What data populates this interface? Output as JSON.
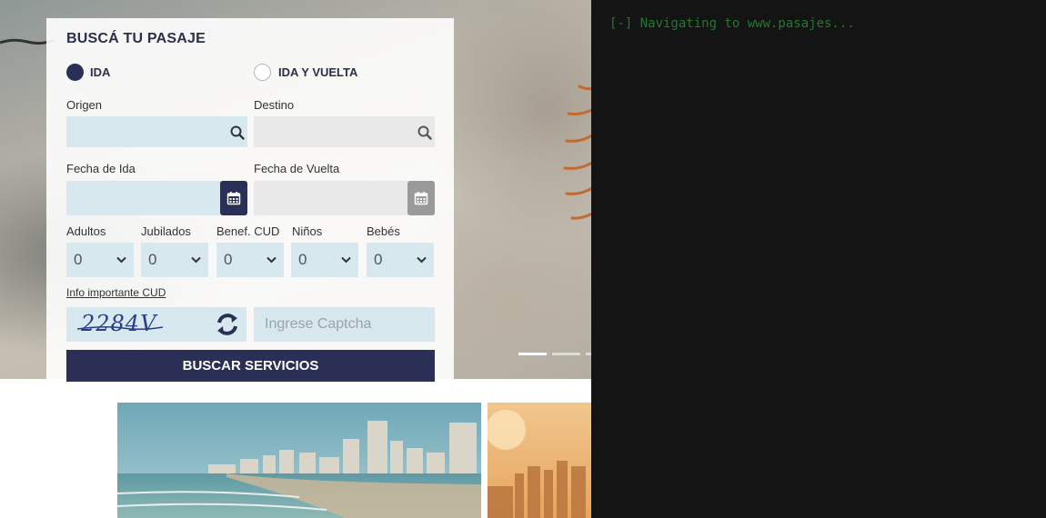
{
  "booking": {
    "title": "BUSCÁ TU PASAJE",
    "trip_type": {
      "options": [
        {
          "label": "IDA",
          "selected": true
        },
        {
          "label": "IDA Y VUELTA",
          "selected": false
        }
      ]
    },
    "origin": {
      "label": "Origen",
      "value": "",
      "placeholder": ""
    },
    "destination": {
      "label": "Destino",
      "value": "",
      "placeholder": ""
    },
    "departure_date": {
      "label": "Fecha de Ida",
      "value": ""
    },
    "return_date": {
      "label": "Fecha de Vuelta",
      "value": ""
    },
    "passengers": [
      {
        "label": "Adultos",
        "value": "0"
      },
      {
        "label": "Jubilados",
        "value": "0"
      },
      {
        "label": "Benef. CUD",
        "value": "0"
      },
      {
        "label": "Niños",
        "value": "0"
      },
      {
        "label": "Bebés",
        "value": "0"
      }
    ],
    "info_link": "Info importante CUD",
    "captcha": {
      "image_text": "2284V",
      "placeholder": "Ingrese Captcha",
      "value": ""
    },
    "search_button": "BUSCAR SERVICIOS"
  },
  "slider": {
    "dots": 3,
    "active_index": 0
  },
  "terminal": {
    "line": "[-] Navigating to www.pasajes..."
  },
  "icons": {
    "search": "search-icon",
    "calendar": "calendar-icon",
    "chevron": "chevron-down-icon",
    "refresh": "refresh-icon"
  },
  "colors": {
    "brand_navy": "#2a2f55",
    "field_bg": "#d7e8ee",
    "terminal_bg": "#141414",
    "terminal_text": "#1f7a2e"
  }
}
